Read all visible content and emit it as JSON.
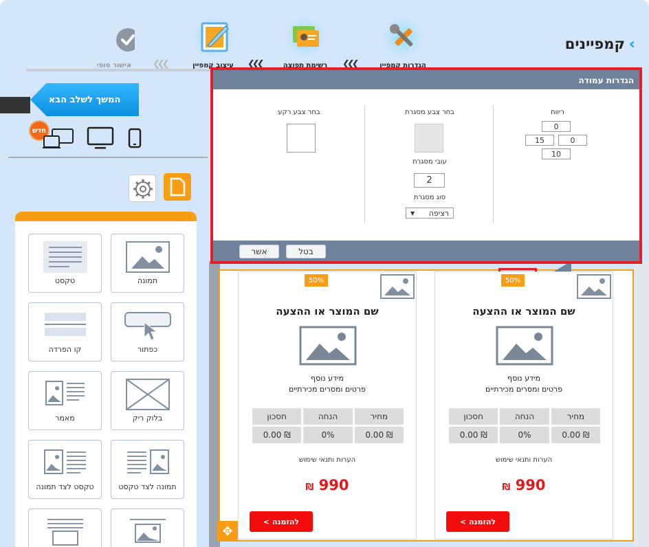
{
  "header": {
    "title": "קמפיינים",
    "steps": [
      {
        "label": "הגדרות קמפיין",
        "icon": "tools-icon"
      },
      {
        "label": "רשימת תפוצה",
        "icon": "contacts-cards-icon"
      },
      {
        "label": "עיצוב קמפיין",
        "icon": "design-quill-icon"
      },
      {
        "label": "אישור סופי",
        "icon": "checkmark-icon"
      }
    ]
  },
  "next_button": "המשך לשלב הבא",
  "badge_new": "חדש",
  "widgets": [
    {
      "label": "תמונה"
    },
    {
      "label": "טקסט"
    },
    {
      "label": "כפתור"
    },
    {
      "label": "קו הפרדה"
    },
    {
      "label": "בלוק ריק"
    },
    {
      "label": "מאמר"
    },
    {
      "label": "תמונה לצד טקסט"
    },
    {
      "label": "טקסט לצד תמונה"
    }
  ],
  "dialog": {
    "title": "הגדרות עמודה",
    "padding_label": "ריווח",
    "padding": {
      "top": "0",
      "left": "15",
      "right": "0",
      "bottom": "10"
    },
    "border_color_label": "בחר צבע מסגרת",
    "border_width_label": "עובי מסגרת",
    "border_width": "2",
    "border_type_label": "סוג מסגרת",
    "border_type": "רציפה",
    "bg_color_label": "בחר צבע רקע",
    "ok": "אשר",
    "cancel": "בטל"
  },
  "cards": [
    {
      "percent": "50%",
      "title": "שם המוצר או ההצעה",
      "info1": "מידע נוסף",
      "info2": "פרטים ומסרים מכירתיים",
      "headers": [
        "מחיר",
        "הנחה",
        "חסכון"
      ],
      "values": [
        "₪ 0.00",
        "0%",
        "₪ 0.00"
      ],
      "notes": "הערות ותנאי שימוש",
      "price": "990",
      "currency": "₪",
      "order": "להזמנה >"
    },
    {
      "percent": "50%",
      "title": "שם המוצר או ההצעה",
      "info1": "מידע נוסף",
      "info2": "פרטים ומסרים מכירתיים",
      "headers": [
        "מחיר",
        "הנחה",
        "חסכון"
      ],
      "values": [
        "₪ 0.00",
        "0%",
        "₪ 0.00"
      ],
      "notes": "הערות ותנאי שימוש",
      "price": "990",
      "currency": "₪",
      "order": "להזמנה >"
    }
  ]
}
